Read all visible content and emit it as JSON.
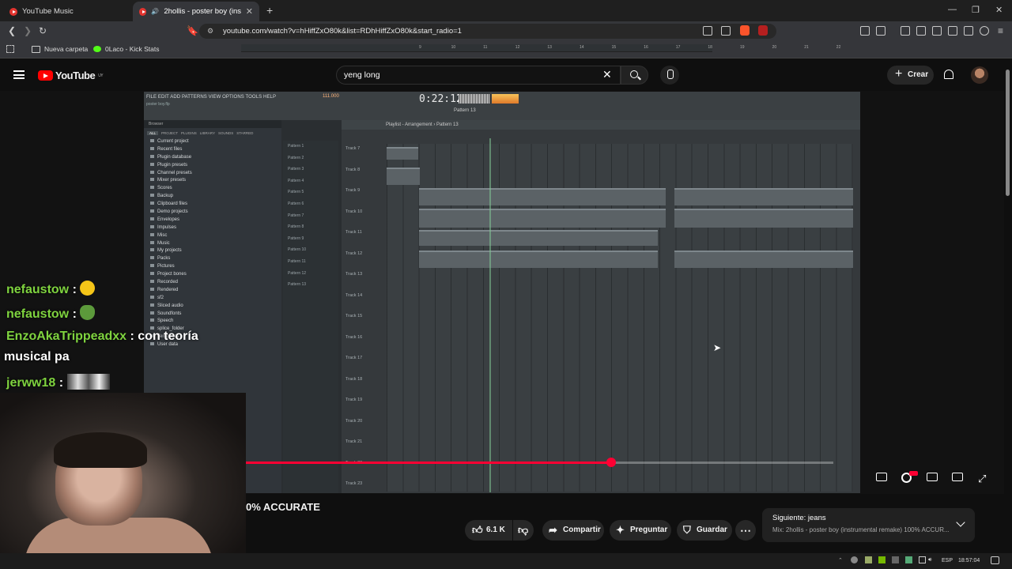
{
  "browser": {
    "tabs": [
      {
        "label": "YouTube Music",
        "active": false
      },
      {
        "label": "2hollis - poster boy (instrume…",
        "active": true
      }
    ],
    "new_tab": "+",
    "url": "youtube.com/watch?v=hHiffZxO80k&list=RDhHiffZxO80k&start_radio=1",
    "bookmarks": [
      {
        "label": "Nueva carpeta",
        "icon": "folder-icon"
      },
      {
        "label": "0Laco - Kick Stats",
        "icon": "kick-icon"
      }
    ],
    "controls": {
      "minimize": "—",
      "restore": "❐",
      "close": "✕"
    }
  },
  "youtube": {
    "logo": "YouTube",
    "region": "UY",
    "search_value": "yeng long",
    "create_label": "Crear",
    "accent": "#ff0000"
  },
  "daw": {
    "menu": "FILE  EDIT  ADD  PATTERNS  VIEW  OPTIONS  TOOLS  HELP",
    "time": "0:22:12",
    "tempo": "111.000",
    "pattern": "Pattern 13",
    "playlist_title": "Playlist - Arrangement › Pattern 13",
    "browser_tabs": [
      "ALL",
      "PROJECT",
      "PLUGINS",
      "LIBRARY",
      "SOUNDS",
      "STARRED"
    ],
    "browser_items": [
      "Current project",
      "Recent files",
      "Plugin database",
      "Plugin presets",
      "Channel presets",
      "Mixer presets",
      "Scores",
      "Backup",
      "Clipboard files",
      "Demo projects",
      "Envelopes",
      "Impulses",
      "Misc",
      "Music",
      "My projects",
      "Packs",
      "Pictures",
      "Project bones",
      "Recorded",
      "Rendered",
      "sf2",
      "Sliced audio",
      "Soundfonts",
      "Speech",
      "splice_folder",
      "Templates",
      "User data"
    ],
    "patterns": [
      "Pattern 1",
      "Pattern 2",
      "Pattern 3",
      "Pattern 4",
      "Pattern 5",
      "Pattern 6",
      "Pattern 7",
      "Pattern 8",
      "Pattern 9",
      "Pattern 10",
      "Pattern 11",
      "Pattern 12",
      "Pattern 13"
    ],
    "tracks": [
      "Track 7",
      "Track 8",
      "Track 9",
      "Track 10",
      "Track 11",
      "Track 12",
      "Track 13",
      "Track 14",
      "Track 15",
      "Track 16",
      "Track 17",
      "Track 18",
      "Track 19",
      "Track 20",
      "Track 21",
      "Track 22",
      "Track 23"
    ],
    "ruler": [
      "9",
      "10",
      "11",
      "12",
      "13",
      "14",
      "15",
      "16",
      "17",
      "18",
      "19",
      "20",
      "21",
      "22"
    ]
  },
  "chat": [
    {
      "name": "nefaustow",
      "sep": " :",
      "emoji": "neutral-face-emoji",
      "text": ""
    },
    {
      "name": "nefaustow",
      "sep": " :",
      "emoji": "pepe-frog-emoji",
      "text": ""
    },
    {
      "name": "EnzoAkaTrippeadxx",
      "sep": " :",
      "text": " con teoría"
    },
    {
      "name": "",
      "sep": "",
      "text": "musical pa"
    },
    {
      "name": "jerww18",
      "sep": " :",
      "emoji": "image-emote",
      "text": ""
    }
  ],
  "video": {
    "title": "0% ACCURATE",
    "progress_played": 0.622,
    "progress_buffer_start": 0.479,
    "progress_buffer_end": 0.622
  },
  "actions": {
    "likes": "6.1 K",
    "share": "Compartir",
    "ask": "Preguntar",
    "save": "Guardar",
    "more": "⋯"
  },
  "up_next": {
    "label": "Siguiente: jeans",
    "subtitle": "Mix: 2hollis - poster boy (instrumental remake) 100% ACCUR..."
  },
  "taskbar": {
    "lang": "ESP",
    "time": "18:57:04"
  }
}
